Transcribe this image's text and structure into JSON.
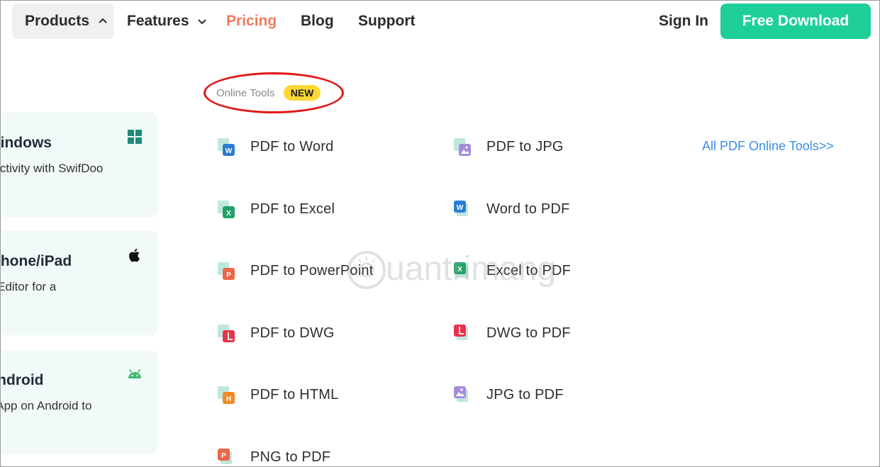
{
  "nav": {
    "products": "Products",
    "features": "Features",
    "pricing": "Pricing",
    "blog": "Blog",
    "support": "Support",
    "sign_in": "Sign In",
    "free_download": "Free Download"
  },
  "platforms": [
    {
      "title": "Windows",
      "desc": "ductivity with SwifDoo",
      "icon": "windows-icon"
    },
    {
      "title": "iPhone/iPad",
      "desc": "F Editor for a",
      "icon": "apple-icon"
    },
    {
      "title": "Android",
      "desc": "g App on Android to",
      "icon": "android-icon"
    }
  ],
  "online_tools": {
    "label": "Online Tools",
    "badge": "NEW",
    "all_link": "All PDF Online Tools>>"
  },
  "tools": [
    {
      "label": "PDF to Word",
      "icon": "word-icon",
      "color": "#2b7cd3"
    },
    {
      "label": "PDF to JPG",
      "icon": "image-icon",
      "color": "#a78bdb"
    },
    {
      "label": "PDF to Excel",
      "icon": "excel-icon",
      "color": "#21a366"
    },
    {
      "label": "Word to PDF",
      "icon": "word-icon",
      "color": "#2b7cd3"
    },
    {
      "label": "PDF to PowerPoint",
      "icon": "powerpoint-icon",
      "color": "#e9674a"
    },
    {
      "label": "Excel to PDF",
      "icon": "excel-icon",
      "color": "#21a366"
    },
    {
      "label": "PDF to DWG",
      "icon": "dwg-icon",
      "color": "#e8334a"
    },
    {
      "label": "DWG to PDF",
      "icon": "dwg-icon",
      "color": "#e8334a"
    },
    {
      "label": "PDF to HTML",
      "icon": "html-icon",
      "color": "#f08a24"
    },
    {
      "label": "JPG to PDF",
      "icon": "image-icon",
      "color": "#a78bdb"
    },
    {
      "label": "PNG to PDF",
      "icon": "png-icon",
      "color": "#e9674a"
    }
  ],
  "watermark": "uantrimang",
  "colors": {
    "accent": "#1ecf99",
    "pricing": "#f07a5c",
    "link": "#3a8ee6",
    "badge": "#fdd835",
    "annotation": "#e01818"
  }
}
